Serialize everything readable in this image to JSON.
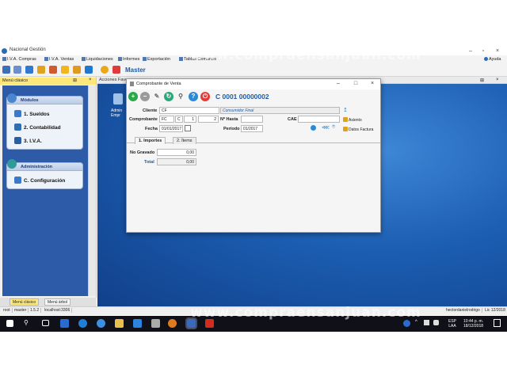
{
  "app": {
    "title": "Nacional Gestión"
  },
  "menu": {
    "items": [
      "I.V.A. Compras",
      "I.V.A. Ventas",
      "Liquidaciones",
      "Informes",
      "Exportación",
      "Tablas Comunes",
      "Ayuda"
    ]
  },
  "toolbar": {
    "master_label": "Master"
  },
  "left_panel": {
    "title": "Menú clásico",
    "groups": [
      {
        "title": "Módulos",
        "items": [
          "1. Sueldos",
          "2. Contabilidad",
          "3. I.V.A."
        ]
      },
      {
        "title": "Administración",
        "items": [
          "C. Configuración"
        ]
      }
    ],
    "tabs": [
      "Menú clásico",
      "Menú árbol"
    ]
  },
  "desktop": {
    "tab_label": "Acciones Favo",
    "icon_label_1": "Admin",
    "icon_label_2": "Empr"
  },
  "dialog": {
    "title": "Comprobante de Venta",
    "doc_number": "C 0001 00000002",
    "labels": {
      "cliente": "Cliente",
      "comprobante": "Comprobante",
      "nro_hasta": "Nº Hasta",
      "cae": "CAE",
      "fecha": "Fecha",
      "periodo": "Período"
    },
    "values": {
      "cliente_code": "CF",
      "cliente_name": "Consumidor Final",
      "comp_type": "FC",
      "comp_letter": "C",
      "comp_pv": "1",
      "comp_num": "2",
      "nro_hasta": "",
      "cae": "",
      "fecha": "01/01/2017",
      "periodo": "01/2017"
    },
    "links": {
      "asiento": "Asiento",
      "datos_factura": "Datos Factura"
    },
    "tabs": [
      "1. Importes",
      "2. Ítems"
    ],
    "importes": {
      "no_gravado_label": "No Gravado",
      "no_gravado_value": "0,00",
      "total_label": "Total",
      "total_value": "0,00"
    }
  },
  "statusbar": {
    "cells": [
      "root",
      "master",
      "1.5.2",
      "localhost:3306",
      "hectordanielrodrigo",
      "Lic 12/2018"
    ]
  },
  "taskbar": {
    "lang_1": "ESP",
    "lang_2": "LAA",
    "time": "10:44 p. m.",
    "date": "18/12/2018"
  },
  "watermark": {
    "text": "www.compraensanjuan.com"
  },
  "colors": {
    "accent": "#1d5ca8",
    "header_yellow": "#ffe87a",
    "desktop_blue": "#1c5eb2"
  }
}
